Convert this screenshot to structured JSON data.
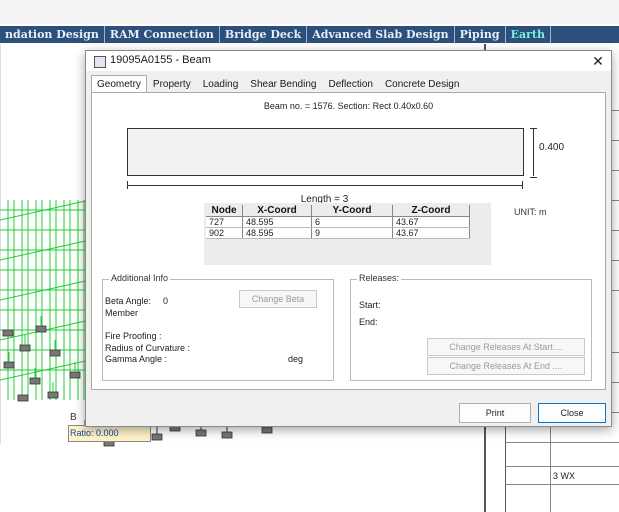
{
  "ribbon": {
    "tabs": [
      "ndation Design",
      "RAM Connection",
      "Bridge Deck",
      "Advanced Slab Design",
      "Piping",
      "Earth"
    ]
  },
  "viewport": {
    "ratio_label": "Ratio: 0.000",
    "b_label": "B",
    "right_cell": "3 WX"
  },
  "dialog": {
    "title": "19095A0155 - Beam",
    "tabs": [
      "Geometry",
      "Property",
      "Loading",
      "Shear Bending",
      "Deflection",
      "Concrete Design"
    ],
    "active_tab": "Geometry",
    "beam_info": "Beam no. = 1576. Section: Rect 0.40x0.60",
    "depth_dim": "0.400",
    "length_label": "Length = 3",
    "unit_label": "UNIT: m",
    "coord_table": {
      "headers": [
        "Node",
        "X-Coord",
        "Y-Coord",
        "Z-Coord"
      ],
      "rows": [
        [
          "727",
          "48.595",
          "6",
          "43.67"
        ],
        [
          "902",
          "48.595",
          "9",
          "43.67"
        ]
      ]
    },
    "additional_info": {
      "title": "Additional Info",
      "beta_angle_label": "Beta Angle:",
      "beta_angle_value": "0",
      "member_label": "Member",
      "fire_proofing_label": "Fire Proofing :",
      "radius_label": "Radius of Curvature :",
      "gamma_label": "Gamma Angle :",
      "gamma_unit": "deg",
      "change_beta_button": "Change Beta"
    },
    "releases": {
      "title": "Releases:",
      "start_label": "Start:",
      "end_label": "End:",
      "change_start_button": "Change Releases At Start....",
      "change_end_button": "Change Releases At End ...."
    },
    "print_button": "Print",
    "close_button": "Close"
  }
}
